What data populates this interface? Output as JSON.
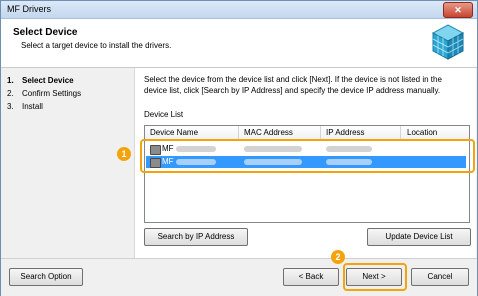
{
  "window": {
    "title": "MF Drivers"
  },
  "header": {
    "title": "Select Device",
    "subtitle": "Select a target device to install the drivers."
  },
  "steps": [
    {
      "number": "1.",
      "label": "Select Device",
      "active": true
    },
    {
      "number": "2.",
      "label": "Confirm Settings",
      "active": false
    },
    {
      "number": "3.",
      "label": "Install",
      "active": false
    }
  ],
  "main": {
    "instructions": "Select the device from the device list and click [Next]. If the device is not listed in the device list, click [Search by IP Address] and specify the device IP address manually.",
    "device_list_label": "Device List",
    "columns": [
      "Device Name",
      "MAC Address",
      "IP Address",
      "Location"
    ],
    "rows": [
      {
        "device_name": "MF",
        "selected": false
      },
      {
        "device_name": "MF",
        "selected": true
      }
    ],
    "search_ip_button": "Search by IP Address",
    "update_list_button": "Update Device List"
  },
  "callouts": [
    "1",
    "2"
  ],
  "footer": {
    "search_option_button": "Search Option",
    "back_button": "< Back",
    "next_button": "Next >",
    "cancel_button": "Cancel"
  },
  "colors": {
    "accent": "#f3a40c",
    "selection": "#3399ff"
  }
}
